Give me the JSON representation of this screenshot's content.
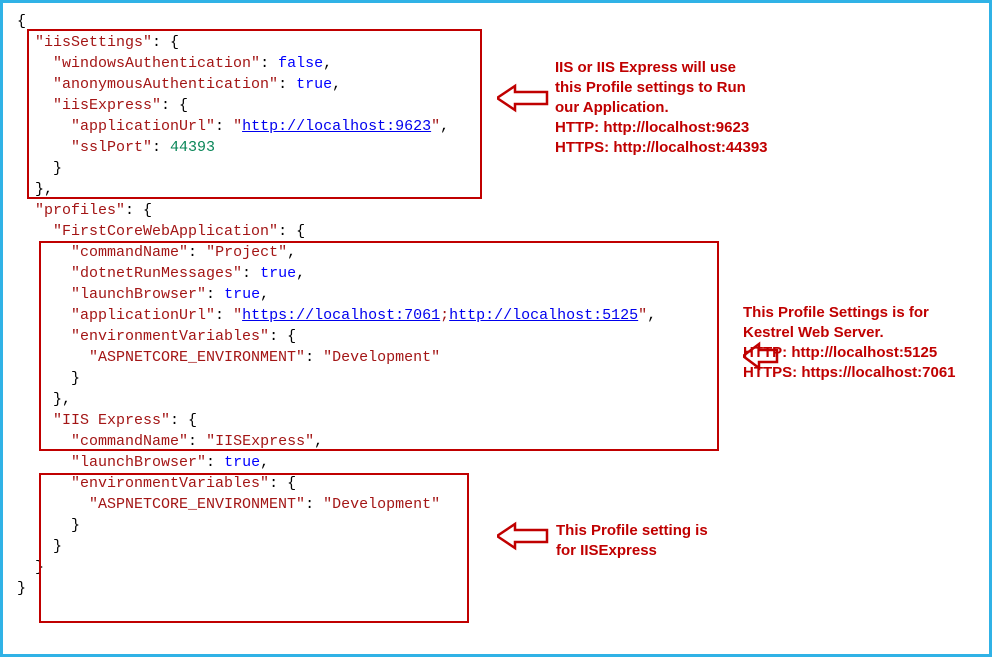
{
  "json": {
    "keys": {
      "iisSettings": "\"iisSettings\"",
      "windowsAuthentication": "\"windowsAuthentication\"",
      "anonymousAuthentication": "\"anonymousAuthentication\"",
      "iisExpress": "\"iisExpress\"",
      "applicationUrl": "\"applicationUrl\"",
      "sslPort": "\"sslPort\"",
      "profiles": "\"profiles\"",
      "FirstCoreWebApplication": "\"FirstCoreWebApplication\"",
      "commandName": "\"commandName\"",
      "dotnetRunMessages": "\"dotnetRunMessages\"",
      "launchBrowser": "\"launchBrowser\"",
      "environmentVariables": "\"environmentVariables\"",
      "ASPNETCORE_ENVIRONMENT": "\"ASPNETCORE_ENVIRONMENT\"",
      "IISExpressProfile": "\"IIS Express\""
    },
    "vals": {
      "false": "false",
      "true": "true",
      "sslPort": "44393",
      "url9623": "http://localhost:9623",
      "url7061": "https://localhost:7061",
      "url5125": "http://localhost:5125",
      "project": "\"Project\"",
      "iisexpress": "\"IISExpress\"",
      "development": "\"Development\""
    }
  },
  "annotations": {
    "a1": {
      "l1": "IIS or IIS Express will use",
      "l2": "this Profile settings to Run",
      "l3": "our Application.",
      "l4": "HTTP: http://localhost:9623",
      "l5": "HTTPS: http://localhost:44393"
    },
    "a2": {
      "l1": "This Profile Settings is for",
      "l2": "Kestrel Web Server.",
      "l3": "HTTP: http://localhost:5125",
      "l4": "HTTPS: https://localhost:7061"
    },
    "a3": {
      "l1": "This Profile setting is",
      "l2": "for IISExpress"
    }
  }
}
